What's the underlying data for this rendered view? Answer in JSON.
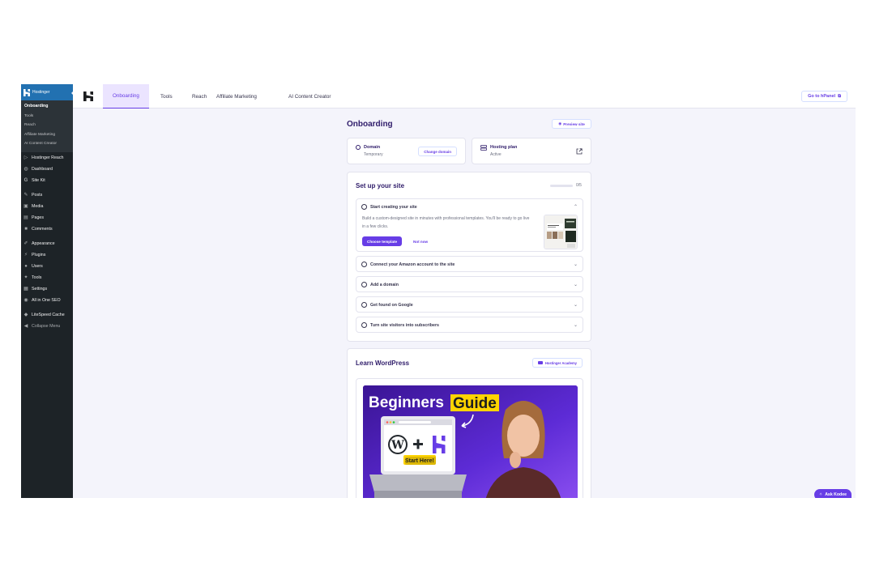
{
  "wp_sidebar": {
    "brand": "Hostinger",
    "submenu": [
      "Onboarding",
      "Tools",
      "Reach",
      "Affiliate Marketing",
      "AI Content Creator"
    ],
    "menu": [
      {
        "label": "Hostinger Reach",
        "icon": "reach-icon"
      },
      {
        "label": "Dashboard",
        "icon": "dashboard-icon"
      },
      {
        "label": "Site Kit",
        "icon": "google-icon"
      },
      {
        "label": "Posts",
        "icon": "pin-icon"
      },
      {
        "label": "Media",
        "icon": "media-icon"
      },
      {
        "label": "Pages",
        "icon": "pages-icon"
      },
      {
        "label": "Comments",
        "icon": "comment-icon"
      },
      {
        "label": "Appearance",
        "icon": "brush-icon"
      },
      {
        "label": "Plugins",
        "icon": "plugin-icon"
      },
      {
        "label": "Users",
        "icon": "user-icon"
      },
      {
        "label": "Tools",
        "icon": "wrench-icon"
      },
      {
        "label": "Settings",
        "icon": "settings-icon"
      },
      {
        "label": "All in One SEO",
        "icon": "seo-icon"
      },
      {
        "label": "LiteSpeed Cache",
        "icon": "litespeed-icon"
      },
      {
        "label": "Collapse Menu",
        "icon": "collapse-icon"
      }
    ]
  },
  "topbar": {
    "tabs": [
      "Onboarding",
      "Tools",
      "Reach",
      "Affiliate Marketing",
      "AI Content Creator"
    ],
    "hpanel_button": "Go to hPanel"
  },
  "main": {
    "title": "Onboarding",
    "preview_button": "Preview site",
    "domain": {
      "label": "Domain",
      "status": "Temporary",
      "button": "Change domain"
    },
    "hosting": {
      "label": "Hosting plan",
      "status": "Active"
    },
    "setup": {
      "title": "Set up your site",
      "progress": "0/5",
      "progress_fraction": 0,
      "tasks": [
        {
          "title": "Start creating your site",
          "expanded": true,
          "description": "Build a custom-designed site in minutes with professional templates. You'll be ready to go live in a few clicks.",
          "primary": "Choose template",
          "secondary": "Not now"
        },
        {
          "title": "Connect your Amazon account to the site"
        },
        {
          "title": "Add a domain"
        },
        {
          "title": "Get found on Google"
        },
        {
          "title": "Turn site visitors into subscribers"
        }
      ]
    },
    "learn": {
      "title": "Learn WordPress",
      "academy_button": "Hostinger Academy",
      "video": {
        "headline_1": "Beginners",
        "headline_2": "Guide",
        "sticker": "Start Here!"
      }
    }
  },
  "ask_kodee": "Ask Kodee",
  "colors": {
    "accent": "#673de6",
    "sidebar": "#1d2327",
    "sidebar_active": "#2271b1",
    "title": "#2f1c6a"
  }
}
